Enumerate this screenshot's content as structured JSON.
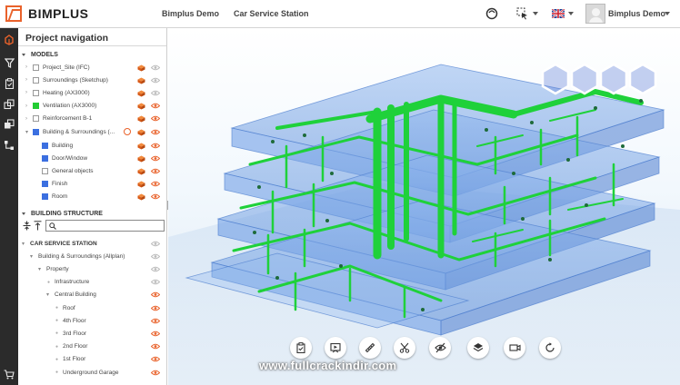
{
  "app": {
    "brand": "BIMPLUS",
    "nav_links": [
      "Bimplus Demo",
      "Car Service Station"
    ],
    "user_name": "Bimplus Demo"
  },
  "rail": {
    "icons": [
      "project-tree-icon",
      "filter-icon",
      "clipboard-icon",
      "layers-icon",
      "compare-icon",
      "hierarchy-icon",
      "cart-icon"
    ]
  },
  "panel": {
    "title": "Project navigation",
    "models_label": "MODELS",
    "models": [
      {
        "label": "Project_Site (IFC)",
        "color": "",
        "checked": false,
        "eye_visible": false
      },
      {
        "label": "Surroundings (Sketchup)",
        "color": "",
        "checked": false,
        "eye_visible": false
      },
      {
        "label": "Heating (AX3000)",
        "color": "",
        "checked": false,
        "eye_visible": false
      },
      {
        "label": "Ventilation (AX3000)",
        "color": "#22cc33",
        "checked": true,
        "eye_visible": true
      },
      {
        "label": "Reinforcement B-1",
        "color": "",
        "checked": false,
        "eye_visible": true
      },
      {
        "label": "Building & Surroundings (...",
        "color": "#3b6fe0",
        "checked": true,
        "eye_visible": true
      }
    ],
    "layers": [
      {
        "label": "Building",
        "color": "#3b6fe0",
        "checked": true
      },
      {
        "label": "Door/Window",
        "color": "#3b6fe0",
        "checked": true
      },
      {
        "label": "General objects",
        "color": "",
        "checked": false
      },
      {
        "label": "Finish",
        "color": "#3b6fe0",
        "checked": true
      },
      {
        "label": "Room",
        "color": "#3b6fe0",
        "checked": true
      }
    ],
    "structure_label": "BUILDING STRUCTURE",
    "search_placeholder": "",
    "structure": [
      {
        "label": "CAR SERVICE STATION",
        "level": 0,
        "bold": true,
        "eye_active": false
      },
      {
        "label": "Building & Surroundings (Allplan)",
        "level": 1,
        "bold": false,
        "eye_active": false
      },
      {
        "label": "Property",
        "level": 2,
        "bold": false,
        "eye_active": false
      },
      {
        "label": "Infrastructure",
        "level": 3,
        "bold": false,
        "eye_active": false
      },
      {
        "label": "Central Building",
        "level": 3,
        "bold": false,
        "eye_active": true
      },
      {
        "label": "Roof",
        "level": 4,
        "bold": false,
        "eye_active": true
      },
      {
        "label": "4th Floor",
        "level": 4,
        "bold": false,
        "eye_active": true
      },
      {
        "label": "3rd Floor",
        "level": 4,
        "bold": false,
        "eye_active": true
      },
      {
        "label": "2nd Floor",
        "level": 4,
        "bold": false,
        "eye_active": true
      },
      {
        "label": "1st Floor",
        "level": 4,
        "bold": false,
        "eye_active": true
      },
      {
        "label": "Underground Garage",
        "level": 4,
        "bold": false,
        "eye_active": true
      }
    ]
  },
  "viewer": {
    "tools": [
      "clipboard-check-icon",
      "presentation-icon",
      "measure-icon",
      "scissors-icon",
      "hide-icon",
      "layers-icon",
      "camera-icon",
      "refresh-icon"
    ],
    "watermark": "www.fullcrackindir.com"
  },
  "colors": {
    "accent": "#e9622b",
    "duct_green": "#1fd13a",
    "building_blue": "#6f9fe6",
    "rail": "#2b2b2b"
  }
}
